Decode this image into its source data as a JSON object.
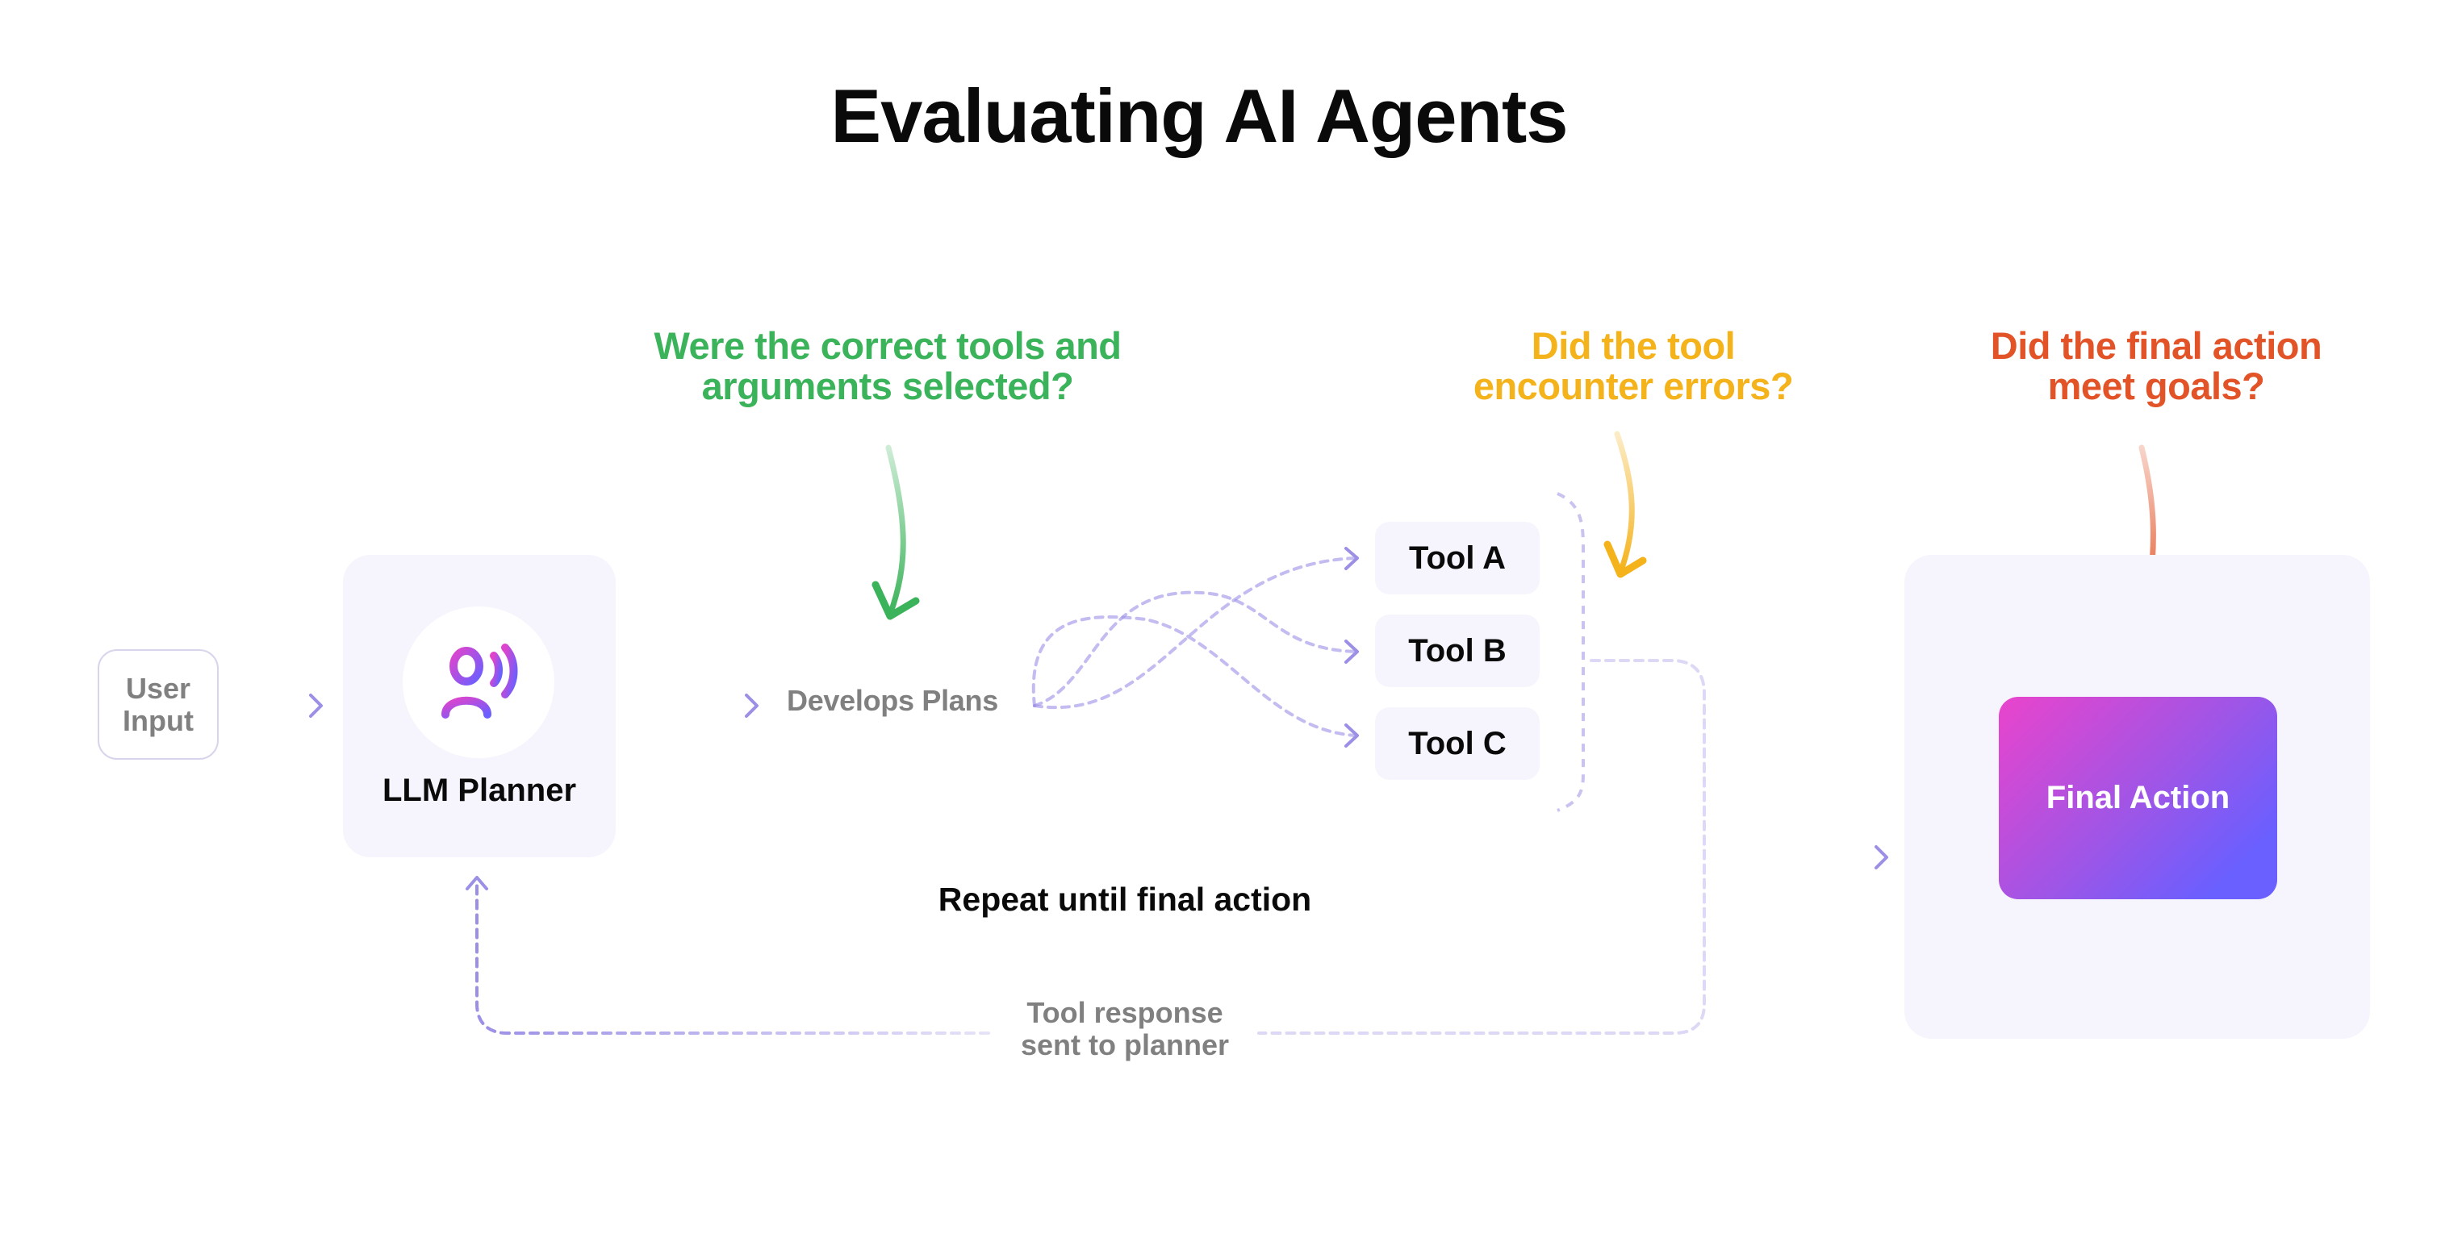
{
  "title": "Evaluating AI Agents",
  "questions": {
    "tool_selection": {
      "text_line1": "Were the correct tools and",
      "text_line2": "arguments selected?",
      "color": "#3bb35a"
    },
    "tool_errors": {
      "text_line1": "Did the tool",
      "text_line2": "encounter errors?",
      "color": "#f4b21b"
    },
    "final_goal": {
      "text_line1": "Did the final action",
      "text_line2": "meet goals?",
      "color": "#e25428"
    }
  },
  "nodes": {
    "user_input": {
      "line1": "User",
      "line2": "Input"
    },
    "llm_planner": {
      "label": "LLM Planner",
      "icon": "person-speaking-icon"
    },
    "develops_plans": {
      "label": "Develops Plans"
    },
    "tools": [
      {
        "label": "Tool A"
      },
      {
        "label": "Tool B"
      },
      {
        "label": "Tool C"
      }
    ],
    "final_action": {
      "label": "Final Action"
    }
  },
  "loop": {
    "repeat_label": "Repeat until final action",
    "response_line1": "Tool response",
    "response_line2": "sent to planner"
  },
  "colors": {
    "connector": "#9b8fe6",
    "card_bg": "#f6f5fd",
    "muted_text": "#808080",
    "gradient_start": "#ea44cc",
    "gradient_end": "#6a5fff"
  }
}
